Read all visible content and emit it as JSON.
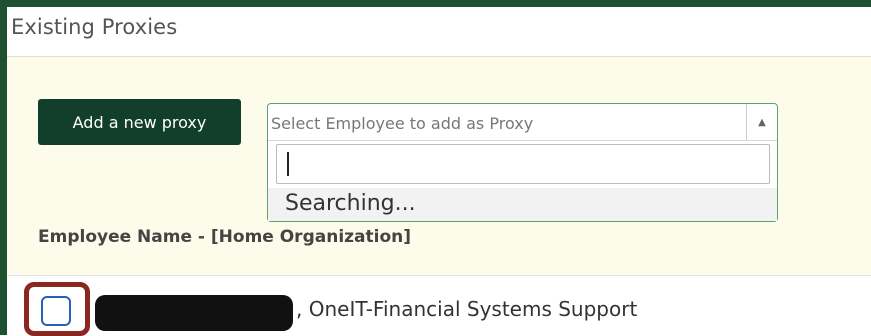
{
  "header": {
    "title": "Existing Proxies"
  },
  "toolbar": {
    "add_proxy_label": "Add a new proxy",
    "employee_select_placeholder": "Select Employee to add as Proxy",
    "dropdown_arrow": "▲",
    "search_value": "",
    "searching_status": "Searching..."
  },
  "table": {
    "column_header": "Employee Name - [Home Organization]",
    "rows": [
      {
        "name_redacted": true,
        "organization": ", OneIT-Financial Systems Support",
        "checked": false
      }
    ]
  },
  "colors": {
    "frame_green": "#1e5130",
    "button_bg": "#123f2b",
    "panel_bg": "#fdfbea",
    "select_border": "#5aa36b",
    "highlight": "#8b2621",
    "checkbox_border": "#2b5fb3"
  }
}
